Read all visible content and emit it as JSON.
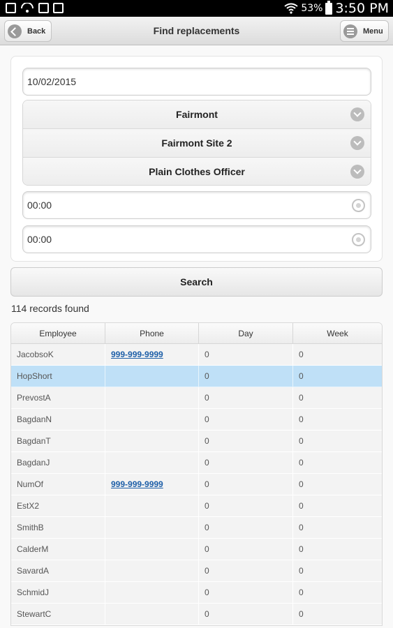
{
  "status_bar": {
    "battery_percent": "53%",
    "time": "3:50 PM"
  },
  "header": {
    "title": "Find replacements",
    "back_label": "Back",
    "menu_label": "Menu"
  },
  "form": {
    "date": "10/02/2015",
    "selects": [
      "Fairmont",
      "Fairmont Site 2",
      "Plain Clothes Officer"
    ],
    "start_time": "00:00",
    "end_time": "00:00"
  },
  "search_label": "Search",
  "records_found": "114 records found",
  "table": {
    "columns": [
      "Employee",
      "Phone",
      "Day",
      "Week"
    ],
    "rows": [
      {
        "employee": "JacobsoK",
        "phone": "999-999-9999",
        "day": "0",
        "week": "0"
      },
      {
        "employee": "HopShort",
        "phone": "",
        "day": "0",
        "week": "0",
        "selected": true
      },
      {
        "employee": "PrevostA",
        "phone": "",
        "day": "0",
        "week": "0"
      },
      {
        "employee": "BagdanN",
        "phone": "",
        "day": "0",
        "week": "0"
      },
      {
        "employee": "BagdanT",
        "phone": "",
        "day": "0",
        "week": "0"
      },
      {
        "employee": "BagdanJ",
        "phone": "",
        "day": "0",
        "week": "0"
      },
      {
        "employee": "NumOf",
        "phone": "999-999-9999",
        "day": "0",
        "week": "0"
      },
      {
        "employee": "EstX2",
        "phone": "",
        "day": "0",
        "week": "0"
      },
      {
        "employee": "SmithB",
        "phone": "",
        "day": "0",
        "week": "0"
      },
      {
        "employee": "CalderM",
        "phone": "",
        "day": "0",
        "week": "0"
      },
      {
        "employee": "SavardA",
        "phone": "",
        "day": "0",
        "week": "0"
      },
      {
        "employee": "SchmidJ",
        "phone": "",
        "day": "0",
        "week": "0"
      },
      {
        "employee": "StewartC",
        "phone": "",
        "day": "0",
        "week": "0"
      }
    ]
  }
}
